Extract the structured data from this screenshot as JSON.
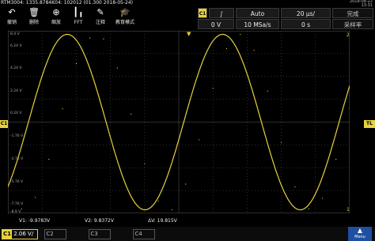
{
  "header": {
    "device_info": "RTM3004: 1335.8784K04: 102012 (01.300 2018-05-24)",
    "date": "2018-08-22",
    "time": "13:31"
  },
  "toolbar": [
    {
      "label": "撤销",
      "icon": "undo-icon"
    },
    {
      "label": "删除",
      "icon": "delete-icon"
    },
    {
      "label": "缩放",
      "icon": "zoom-icon"
    },
    {
      "label": "FFT",
      "icon": "fft-icon"
    },
    {
      "label": "注释",
      "icon": "annotate-icon"
    },
    {
      "label": "教育模式",
      "icon": "education-icon"
    }
  ],
  "trigger_panel": {
    "channel": "C1",
    "slope_symbol": "∫",
    "mode": "Auto",
    "timebase": "20 µs/",
    "status": "完成",
    "level": "0 V",
    "sample_rate": "10 MSa/s",
    "position": "0 s",
    "sample_rate_label": "采样率"
  },
  "y_axis_labels": [
    "8.4 V",
    "6.24 V",
    "4.24 V",
    "2.24 V",
    "0.24 V",
    "-1.76 V",
    "-3.76 V",
    "-5.76 V",
    "-7.76 V",
    "-8.9 V"
  ],
  "markers": {
    "channel": "C1",
    "trigger": "TL",
    "cursor1": "1",
    "cursor2": "2"
  },
  "measurements": {
    "v1": "V1: -9.9783V",
    "v2": "V2: 9.8372V",
    "dv": "ΔV: 19.815V"
  },
  "bottom": {
    "ch1_scale": "2.06 V/",
    "ch2": "C2",
    "ch3": "C3",
    "ch4": "C4",
    "menu_label": "Menu"
  },
  "colors": {
    "trace": "#e6d23b",
    "grid": "#5a5a5a",
    "background": "#000000",
    "menu": "#1f4fa0"
  },
  "chart_data": {
    "type": "line",
    "x_unit": "µs",
    "y_unit": "V",
    "xlim": [
      -100,
      100
    ],
    "ylim": [
      -10.3,
      10.3
    ],
    "frequency_khz": 11.0,
    "amplitude_v": 9.9,
    "series": [
      {
        "x": [
          -100,
          -92,
          -84,
          -76,
          -68,
          -60,
          -52,
          -44,
          -36,
          -28,
          -20,
          -12,
          -4,
          4,
          12,
          20,
          28,
          36,
          44,
          52,
          60,
          68,
          76,
          84,
          92,
          100
        ],
        "values": [
          -7.3,
          -9.8,
          -8.5,
          -4.2,
          1.5,
          6.6,
          9.5,
          9.4,
          6.1,
          0.9,
          -4.7,
          -8.9,
          -9.9,
          -7.0,
          -2.0,
          3.8,
          8.3,
          9.9,
          8.1,
          3.5,
          -2.3,
          -7.3,
          -9.8,
          -8.6,
          -4.2,
          1.6
        ]
      }
    ]
  }
}
